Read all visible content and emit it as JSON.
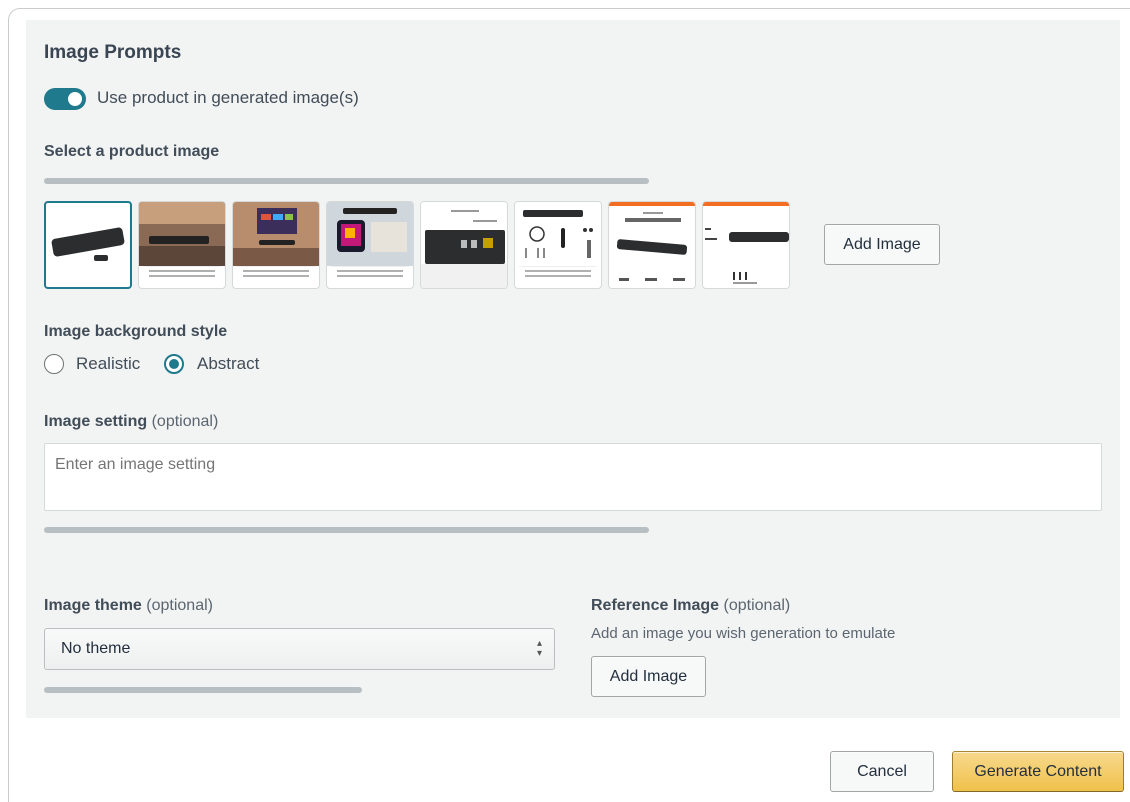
{
  "section_title": "Image Prompts",
  "use_product_toggle": {
    "label": "Use product in generated image(s)",
    "on": true
  },
  "select_product": {
    "label": "Select a product image",
    "add_image_label": "Add Image",
    "thumbnails": [
      {
        "kind": "soundbar",
        "selected": true
      },
      {
        "kind": "lifestyle-room"
      },
      {
        "kind": "tv-lifestyle"
      },
      {
        "kind": "feature-screen"
      },
      {
        "kind": "back-panel"
      },
      {
        "kind": "in-the-box"
      },
      {
        "kind": "title-card"
      },
      {
        "kind": "compare-card"
      }
    ]
  },
  "background_style": {
    "label": "Image background style",
    "options": [
      {
        "label": "Realistic",
        "checked": false
      },
      {
        "label": "Abstract",
        "checked": true
      }
    ]
  },
  "image_setting": {
    "label": "Image setting",
    "optional": "(optional)",
    "placeholder": "Enter an image setting"
  },
  "image_theme": {
    "label": "Image theme",
    "optional": "(optional)",
    "selected": "No theme"
  },
  "reference_image": {
    "label": "Reference Image",
    "optional": "(optional)",
    "help": "Add an image you wish generation to emulate",
    "add_image_label": "Add Image"
  },
  "footer": {
    "cancel_label": "Cancel",
    "generate_label": "Generate Content"
  },
  "colors": {
    "accent": "#1e7a8c",
    "primary_button": "#f0c14b",
    "panel_bg": "#f2f3f3"
  }
}
